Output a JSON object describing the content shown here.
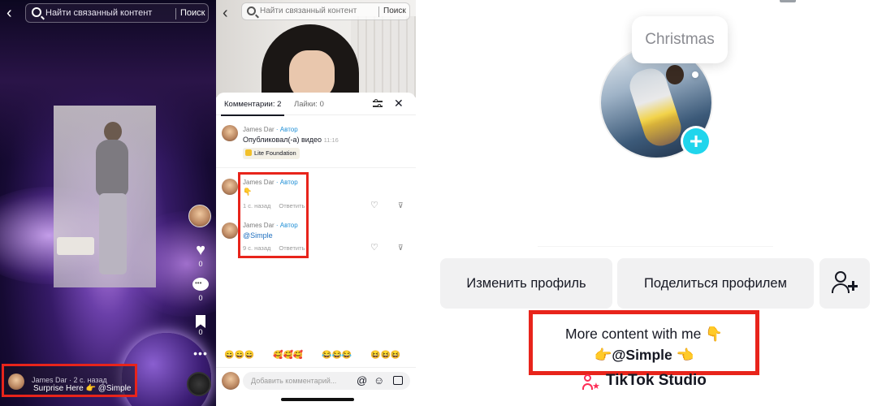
{
  "video_panel": {
    "search": {
      "placeholder": "Найти связанный контент",
      "button": "Поиск"
    },
    "side": {
      "like_count": "0",
      "comment_count": "0",
      "save_count": "0"
    },
    "caption": {
      "meta": "James Dar · 2 с. назад",
      "text": "Surprise Here 👉 @Simple"
    }
  },
  "comments_panel": {
    "search": {
      "placeholder": "Найти связанный контент",
      "button": "Поиск"
    },
    "tabs": {
      "comments": "Комментарии: 2",
      "likes": "Лайки: 0"
    },
    "posted": {
      "name": "James Dar",
      "author": " · Автор",
      "text": "Опубликовал(-а) видео",
      "time": "11:16",
      "badge": "Lite Foundation"
    },
    "comments": [
      {
        "name": "James Dar",
        "author": " · Автор",
        "text": "👇",
        "time": "1 с. назад",
        "reply": "Ответить"
      },
      {
        "name": "James Dar",
        "author": " · Автор",
        "text": "@Simple",
        "time": "9 с. назад",
        "reply": "Ответить"
      }
    ],
    "emoji_groups": [
      "😄😄😄",
      "🥰🥰🥰",
      "😂😂😂",
      "😆😆😆"
    ],
    "input": {
      "placeholder": "Добавить комментарий..."
    }
  },
  "profile_panel": {
    "note": "Christmas",
    "buttons": {
      "edit": "Изменить профиль",
      "share": "Поделиться профилем"
    },
    "bio": {
      "line1": "More content with me 👇",
      "line2": "👉@Simple 👈"
    },
    "studio": "TikTok Studio",
    "colors": {
      "accent": "#20d5ec",
      "highlight": "#e8241b",
      "brand": "#fe2c55"
    }
  }
}
